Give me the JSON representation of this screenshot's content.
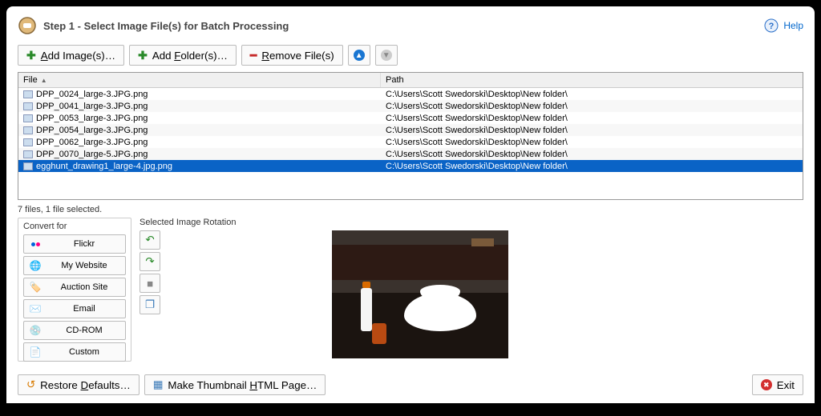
{
  "header": {
    "title": "Step 1 - Select Image File(s) for Batch Processing",
    "help": "Help"
  },
  "toolbar": {
    "add_image": "Add Image(s)…",
    "add_folder": "Add Folder(s)…",
    "remove_files": "Remove File(s)"
  },
  "grid": {
    "col_file": "File",
    "col_path": "Path",
    "rows": [
      {
        "file": "DPP_0024_large-3.JPG.png",
        "path": "C:\\Users\\Scott Swedorski\\Desktop\\New folder\\",
        "selected": false
      },
      {
        "file": "DPP_0041_large-3.JPG.png",
        "path": "C:\\Users\\Scott Swedorski\\Desktop\\New folder\\",
        "selected": false
      },
      {
        "file": "DPP_0053_large-3.JPG.png",
        "path": "C:\\Users\\Scott Swedorski\\Desktop\\New folder\\",
        "selected": false
      },
      {
        "file": "DPP_0054_large-3.JPG.png",
        "path": "C:\\Users\\Scott Swedorski\\Desktop\\New folder\\",
        "selected": false
      },
      {
        "file": "DPP_0062_large-3.JPG.png",
        "path": "C:\\Users\\Scott Swedorski\\Desktop\\New folder\\",
        "selected": false
      },
      {
        "file": "DPP_0070_large-5.JPG.png",
        "path": "C:\\Users\\Scott Swedorski\\Desktop\\New folder\\",
        "selected": false
      },
      {
        "file": "egghunt_drawing1_large-4.jpg.png",
        "path": "C:\\Users\\Scott Swedorski\\Desktop\\New folder\\",
        "selected": true
      }
    ]
  },
  "status": "7 files, 1 file selected.",
  "convert": {
    "label": "Convert for",
    "flickr": "Flickr",
    "website": "My Website",
    "auction": "Auction Site",
    "email": "Email",
    "cdrom": "CD-ROM",
    "custom": "Custom"
  },
  "rotation": {
    "label": "Selected Image Rotation"
  },
  "footer": {
    "restore": "Restore Defaults…",
    "thumbnail": "Make Thumbnail HTML Page…",
    "exit": "Exit"
  }
}
